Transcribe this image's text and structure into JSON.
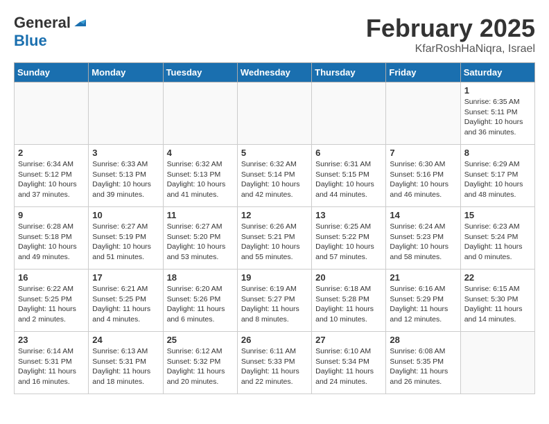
{
  "logo": {
    "general": "General",
    "blue": "Blue"
  },
  "title": "February 2025",
  "location": "KfarRoshHaNiqra, Israel",
  "weekdays": [
    "Sunday",
    "Monday",
    "Tuesday",
    "Wednesday",
    "Thursday",
    "Friday",
    "Saturday"
  ],
  "weeks": [
    [
      {
        "day": "",
        "info": ""
      },
      {
        "day": "",
        "info": ""
      },
      {
        "day": "",
        "info": ""
      },
      {
        "day": "",
        "info": ""
      },
      {
        "day": "",
        "info": ""
      },
      {
        "day": "",
        "info": ""
      },
      {
        "day": "1",
        "info": "Sunrise: 6:35 AM\nSunset: 5:11 PM\nDaylight: 10 hours and 36 minutes."
      }
    ],
    [
      {
        "day": "2",
        "info": "Sunrise: 6:34 AM\nSunset: 5:12 PM\nDaylight: 10 hours and 37 minutes."
      },
      {
        "day": "3",
        "info": "Sunrise: 6:33 AM\nSunset: 5:13 PM\nDaylight: 10 hours and 39 minutes."
      },
      {
        "day": "4",
        "info": "Sunrise: 6:32 AM\nSunset: 5:13 PM\nDaylight: 10 hours and 41 minutes."
      },
      {
        "day": "5",
        "info": "Sunrise: 6:32 AM\nSunset: 5:14 PM\nDaylight: 10 hours and 42 minutes."
      },
      {
        "day": "6",
        "info": "Sunrise: 6:31 AM\nSunset: 5:15 PM\nDaylight: 10 hours and 44 minutes."
      },
      {
        "day": "7",
        "info": "Sunrise: 6:30 AM\nSunset: 5:16 PM\nDaylight: 10 hours and 46 minutes."
      },
      {
        "day": "8",
        "info": "Sunrise: 6:29 AM\nSunset: 5:17 PM\nDaylight: 10 hours and 48 minutes."
      }
    ],
    [
      {
        "day": "9",
        "info": "Sunrise: 6:28 AM\nSunset: 5:18 PM\nDaylight: 10 hours and 49 minutes."
      },
      {
        "day": "10",
        "info": "Sunrise: 6:27 AM\nSunset: 5:19 PM\nDaylight: 10 hours and 51 minutes."
      },
      {
        "day": "11",
        "info": "Sunrise: 6:27 AM\nSunset: 5:20 PM\nDaylight: 10 hours and 53 minutes."
      },
      {
        "day": "12",
        "info": "Sunrise: 6:26 AM\nSunset: 5:21 PM\nDaylight: 10 hours and 55 minutes."
      },
      {
        "day": "13",
        "info": "Sunrise: 6:25 AM\nSunset: 5:22 PM\nDaylight: 10 hours and 57 minutes."
      },
      {
        "day": "14",
        "info": "Sunrise: 6:24 AM\nSunset: 5:23 PM\nDaylight: 10 hours and 58 minutes."
      },
      {
        "day": "15",
        "info": "Sunrise: 6:23 AM\nSunset: 5:24 PM\nDaylight: 11 hours and 0 minutes."
      }
    ],
    [
      {
        "day": "16",
        "info": "Sunrise: 6:22 AM\nSunset: 5:25 PM\nDaylight: 11 hours and 2 minutes."
      },
      {
        "day": "17",
        "info": "Sunrise: 6:21 AM\nSunset: 5:25 PM\nDaylight: 11 hours and 4 minutes."
      },
      {
        "day": "18",
        "info": "Sunrise: 6:20 AM\nSunset: 5:26 PM\nDaylight: 11 hours and 6 minutes."
      },
      {
        "day": "19",
        "info": "Sunrise: 6:19 AM\nSunset: 5:27 PM\nDaylight: 11 hours and 8 minutes."
      },
      {
        "day": "20",
        "info": "Sunrise: 6:18 AM\nSunset: 5:28 PM\nDaylight: 11 hours and 10 minutes."
      },
      {
        "day": "21",
        "info": "Sunrise: 6:16 AM\nSunset: 5:29 PM\nDaylight: 11 hours and 12 minutes."
      },
      {
        "day": "22",
        "info": "Sunrise: 6:15 AM\nSunset: 5:30 PM\nDaylight: 11 hours and 14 minutes."
      }
    ],
    [
      {
        "day": "23",
        "info": "Sunrise: 6:14 AM\nSunset: 5:31 PM\nDaylight: 11 hours and 16 minutes."
      },
      {
        "day": "24",
        "info": "Sunrise: 6:13 AM\nSunset: 5:31 PM\nDaylight: 11 hours and 18 minutes."
      },
      {
        "day": "25",
        "info": "Sunrise: 6:12 AM\nSunset: 5:32 PM\nDaylight: 11 hours and 20 minutes."
      },
      {
        "day": "26",
        "info": "Sunrise: 6:11 AM\nSunset: 5:33 PM\nDaylight: 11 hours and 22 minutes."
      },
      {
        "day": "27",
        "info": "Sunrise: 6:10 AM\nSunset: 5:34 PM\nDaylight: 11 hours and 24 minutes."
      },
      {
        "day": "28",
        "info": "Sunrise: 6:08 AM\nSunset: 5:35 PM\nDaylight: 11 hours and 26 minutes."
      },
      {
        "day": "",
        "info": ""
      }
    ]
  ]
}
